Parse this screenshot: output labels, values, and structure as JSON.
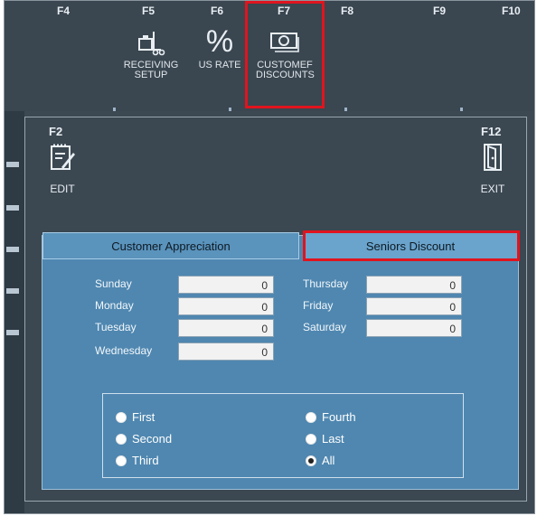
{
  "toolbar": {
    "fkeys": {
      "f4": "F4",
      "f5": "F5",
      "f6": "F6",
      "f7": "F7",
      "f8": "F8",
      "f9": "F9",
      "f10": "F10"
    },
    "receiving_setup": [
      "RECEIVING",
      "SETUP"
    ],
    "us_rate": "US RATE",
    "customer_discounts": [
      "CUSTOMEF",
      "DISCOUNTS"
    ]
  },
  "dialog": {
    "edit_key": "F2",
    "edit_label": "EDIT",
    "exit_key": "F12",
    "exit_label": "EXIT",
    "tabs": [
      "Customer Appreciation",
      "Seniors Discount"
    ],
    "days_left": [
      {
        "label": "Sunday",
        "value": "0"
      },
      {
        "label": "Monday",
        "value": "0"
      },
      {
        "label": "Tuesday",
        "value": "0"
      },
      {
        "label": "Wednesday",
        "value": "0"
      }
    ],
    "days_right": [
      {
        "label": "Thursday",
        "value": "0"
      },
      {
        "label": "Friday",
        "value": "0"
      },
      {
        "label": "Saturday",
        "value": "0"
      }
    ],
    "radios_left": [
      "First",
      "Second",
      "Third"
    ],
    "radios_right": [
      "Fourth",
      "Last",
      "All"
    ],
    "selected_radio": "All"
  },
  "colors": {
    "highlight": "#e0141e",
    "panel": "#4f87b0",
    "background": "#3c4852"
  }
}
